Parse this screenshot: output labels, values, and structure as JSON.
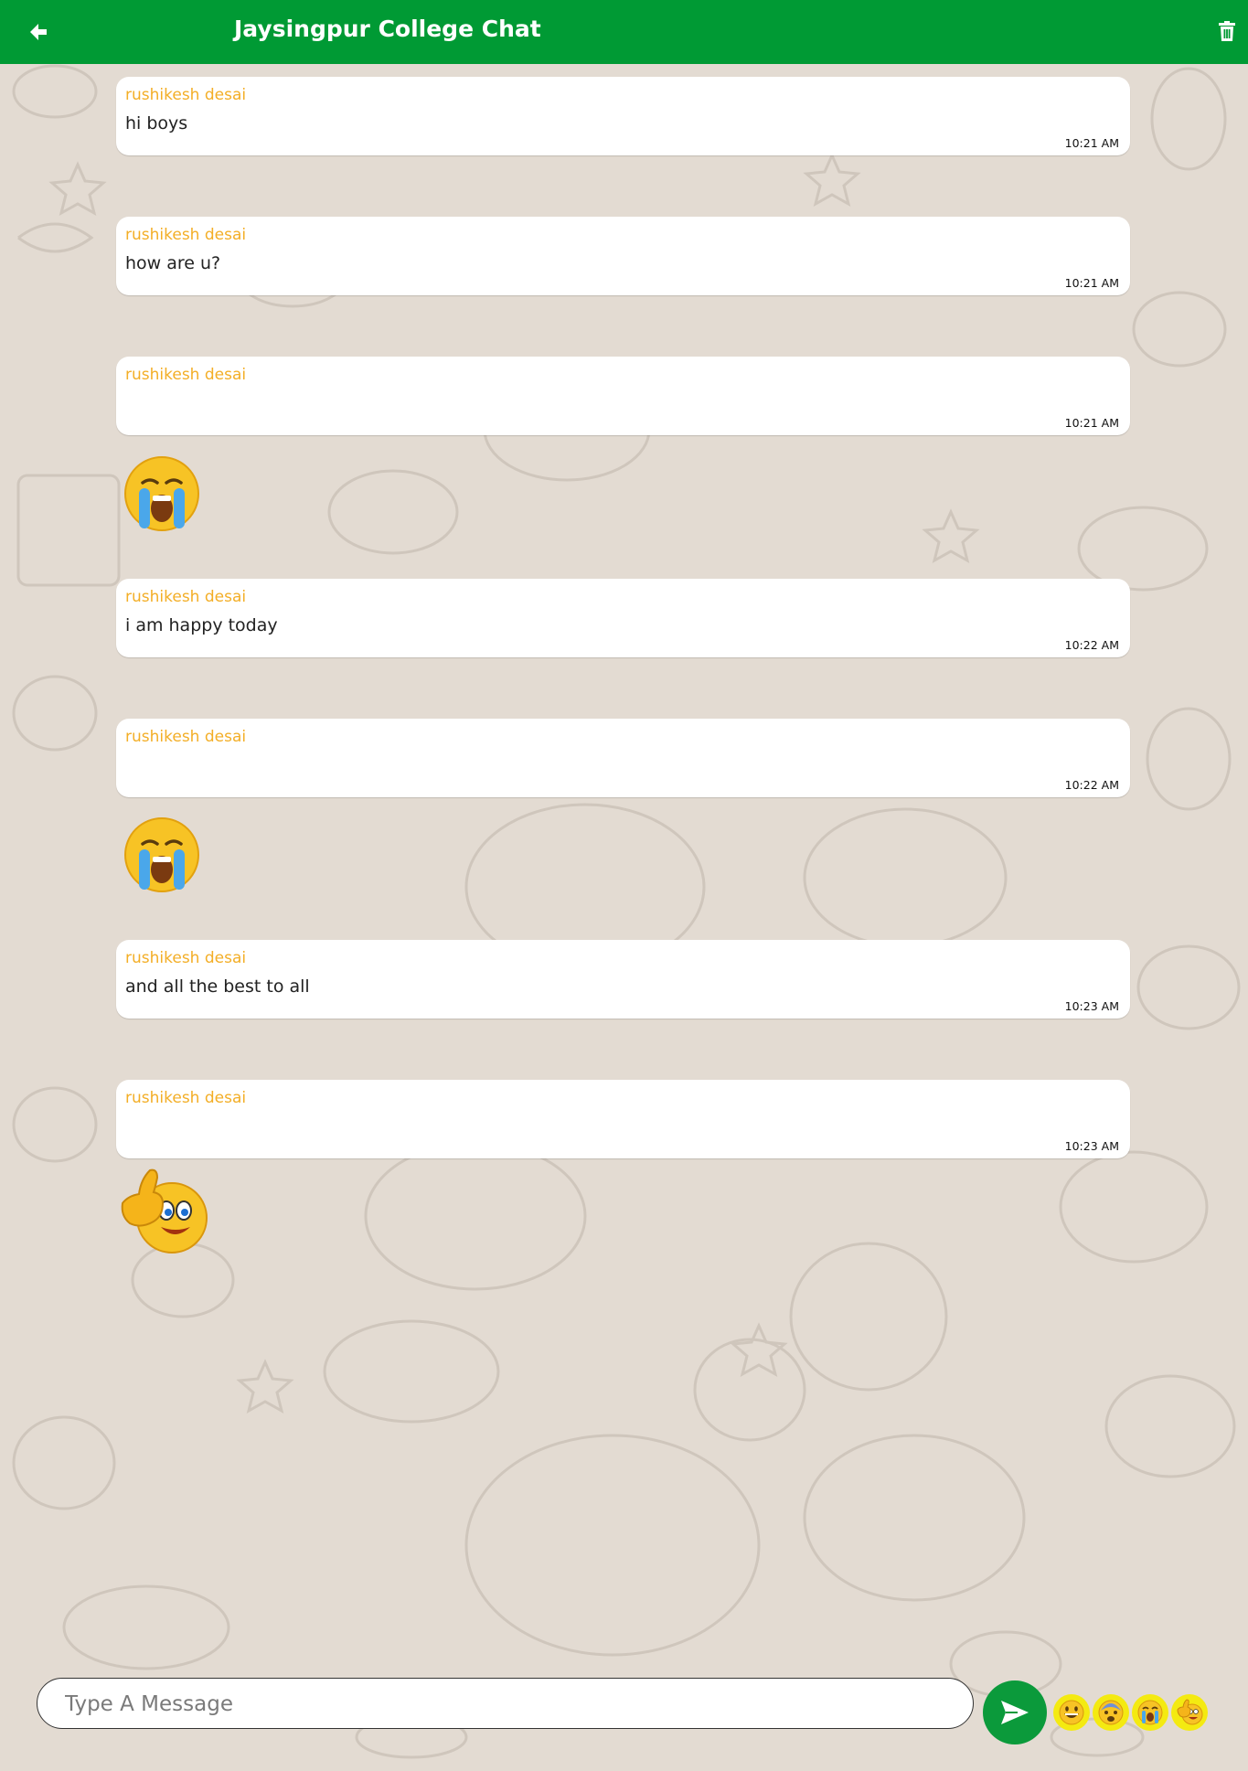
{
  "header": {
    "title": "Jaysingpur College Chat",
    "back_icon": "arrow-left-icon",
    "delete_icon": "trash-icon",
    "accent": "#009a34"
  },
  "messages": [
    {
      "sender": "rushikesh desai",
      "text": "hi boys",
      "time": "10:21 AM"
    },
    {
      "sender": "rushikesh desai",
      "text": "how are u?",
      "time": "10:21 AM"
    },
    {
      "sender": "rushikesh desai",
      "text": "",
      "time": "10:21 AM",
      "attachment": "loudly-crying-face-emoji"
    },
    {
      "sender": "rushikesh desai",
      "text": "i am happy today",
      "time": "10:22 AM"
    },
    {
      "sender": "rushikesh desai",
      "text": "",
      "time": "10:22 AM",
      "attachment": "loudly-crying-face-emoji"
    },
    {
      "sender": "rushikesh desai",
      "text": "and all the best to all",
      "time": "10:23 AM"
    },
    {
      "sender": "rushikesh desai",
      "text": "",
      "time": "10:23 AM",
      "attachment": "thumbs-up-smiley-emoji"
    }
  ],
  "composer": {
    "placeholder": "Type A Message",
    "send_icon": "send-icon",
    "quick_emojis": [
      "grinning-face-emoji",
      "fearful-face-emoji",
      "crying-face-emoji",
      "thumbs-up-smiley-emoji"
    ]
  },
  "colors": {
    "sender_name": "#f3ae26",
    "background": "#e3dbd2",
    "send_button": "#0b9a3b",
    "quick_emoji_bg": "#f4ea11"
  }
}
